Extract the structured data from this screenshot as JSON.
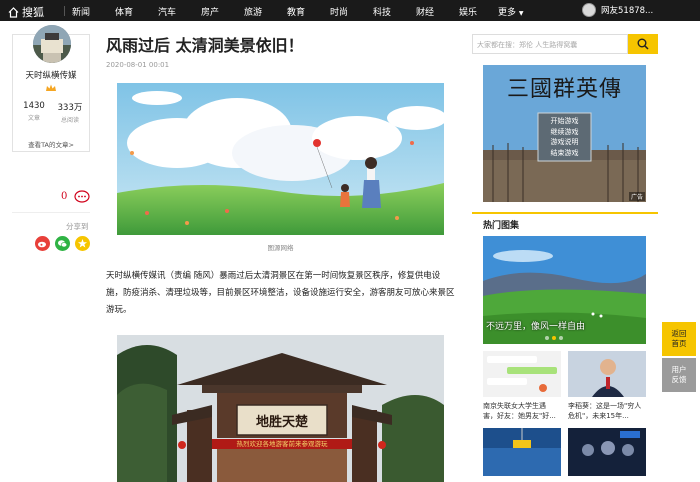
{
  "topbar": {
    "logo_text": "搜狐",
    "nav": [
      "新闻",
      "体育",
      "汽车",
      "房产",
      "旅游",
      "教育",
      "时尚",
      "科技",
      "财经",
      "娱乐"
    ],
    "more_label": "更多",
    "user_name": "网友51878..."
  },
  "author": {
    "name": "天时纵横传媒",
    "articles_count": "1430",
    "articles_label": "文章",
    "reads_count": "333万",
    "reads_label": "总阅读",
    "view_link": "查看TA的文章>"
  },
  "interaction": {
    "comment_count": "0",
    "share_label": "分享到"
  },
  "article": {
    "title": "风雨过后 太清洞美景依旧！",
    "date": "2020-08-01 00:01",
    "image1_caption": "图源网络",
    "paragraph": "天时纵横传媒讯（责编 随风）暴雨过后太清洞景区在第一时间恢复景区秩序，修复供电设施，防疫消杀、清理垃圾等，目前景区环境整洁，设备设施运行安全，游客朋友可放心来景区游玩。",
    "gate_sign": "地胜天楚",
    "gate_banner": "热烈欢迎各地游客前来参观游玩"
  },
  "sidebar": {
    "search_placeholder": "大家都在搜：郑伦 人生路得窝囊",
    "ad": {
      "game_title": "三國群英傳",
      "menu": [
        "开始游戏",
        "继续游戏",
        "游戏说明",
        "结束游戏"
      ],
      "tag": "广告"
    },
    "hot_title": "热门图集",
    "hot_main_caption": "不远万里，像风一样自由",
    "thumbs": [
      {
        "line1": "南京失联女大学生遇",
        "line2": "害，好友：她男友\"好..."
      },
      {
        "line1": "李稻葵：这是一场\"穷人",
        "line2": "危机\"，未来15年..."
      }
    ]
  },
  "float": {
    "top_label_1": "返回",
    "top_label_2": "首页",
    "feedback_label_1": "用户",
    "feedback_label_2": "反馈"
  },
  "colors": {
    "topbar": "#1a1a1a",
    "accent": "#f6c500",
    "comment_red": "#d0021b"
  }
}
